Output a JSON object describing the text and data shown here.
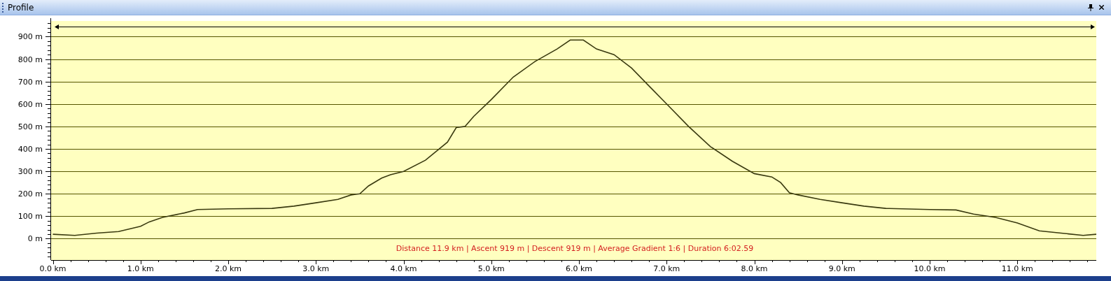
{
  "window": {
    "title": "Profile"
  },
  "chart_data": {
    "type": "line",
    "grid": true,
    "xlim": [
      0,
      11.9
    ],
    "ylim": [
      -95,
      970
    ],
    "x": [
      0,
      0.25,
      0.5,
      0.75,
      1.0,
      1.1,
      1.25,
      1.5,
      1.65,
      2.0,
      2.5,
      2.75,
      3.0,
      3.25,
      3.4,
      3.5,
      3.6,
      3.75,
      3.85,
      4.0,
      4.25,
      4.5,
      4.6,
      4.7,
      4.8,
      5.0,
      5.25,
      5.5,
      5.75,
      5.9,
      6.05,
      6.2,
      6.4,
      6.6,
      6.8,
      7.0,
      7.25,
      7.5,
      7.75,
      8.0,
      8.2,
      8.3,
      8.4,
      8.5,
      8.75,
      9.0,
      9.25,
      9.5,
      10.0,
      10.3,
      10.5,
      10.75,
      11.0,
      11.25,
      11.5,
      11.75,
      11.9
    ],
    "series": [
      {
        "color": "#3a3a10",
        "values": [
          20,
          15,
          25,
          32,
          55,
          75,
          95,
          115,
          130,
          133,
          135,
          145,
          160,
          175,
          195,
          200,
          235,
          270,
          285,
          300,
          350,
          430,
          495,
          500,
          545,
          620,
          720,
          790,
          845,
          885,
          885,
          845,
          820,
          760,
          680,
          600,
          500,
          410,
          345,
          290,
          275,
          250,
          205,
          195,
          175,
          160,
          145,
          135,
          130,
          128,
          110,
          95,
          70,
          35,
          25,
          15,
          20
        ]
      }
    ],
    "xticks": [
      {
        "value": 0,
        "label": "0.0 km"
      },
      {
        "value": 1,
        "label": "1.0 km"
      },
      {
        "value": 2,
        "label": "2.0 km"
      },
      {
        "value": 3,
        "label": "3.0 km"
      },
      {
        "value": 4,
        "label": "4.0 km"
      },
      {
        "value": 5,
        "label": "5.0 km"
      },
      {
        "value": 6,
        "label": "6.0 km"
      },
      {
        "value": 7,
        "label": "7.0 km"
      },
      {
        "value": 8,
        "label": "8.0 km"
      },
      {
        "value": 9,
        "label": "9.0 km"
      },
      {
        "value": 10,
        "label": "10.0 km"
      },
      {
        "value": 11,
        "label": "11.0 km"
      }
    ],
    "yticks": [
      {
        "value": 0,
        "label": "0 m"
      },
      {
        "value": 100,
        "label": "100 m"
      },
      {
        "value": 200,
        "label": "200 m"
      },
      {
        "value": 300,
        "label": "300 m"
      },
      {
        "value": 400,
        "label": "400 m"
      },
      {
        "value": 500,
        "label": "500 m"
      },
      {
        "value": 600,
        "label": "600 m"
      },
      {
        "value": 700,
        "label": "700 m"
      },
      {
        "value": 800,
        "label": "800 m"
      },
      {
        "value": 900,
        "label": "900 m"
      }
    ],
    "annotations": [
      "Distance 11.9 km | Ascent 919 m | Descent 919 m | Average Gradient 1:6 | Duration 6:02.59"
    ]
  }
}
